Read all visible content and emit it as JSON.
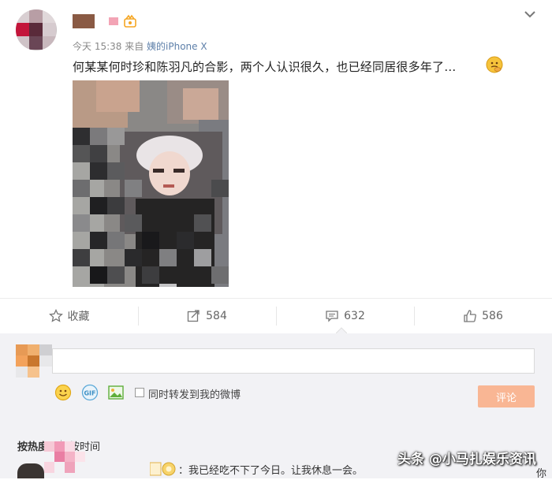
{
  "post": {
    "meta_prefix": "今天 15:38 来自 ",
    "device": "姨的iPhone X",
    "text": "何某某何时珍和陈羽凡的合影，两个人认识很久，也已经同居很多年了…",
    "icons": {
      "vip": "vip-crown-icon",
      "options": "chevron-down-icon",
      "emoji": "thinking-emoji-icon"
    }
  },
  "actions": {
    "favorite_label": "收藏",
    "repost_count": "584",
    "comment_count": "632",
    "like_count": "586"
  },
  "comment_box": {
    "input_value": "",
    "repost_checkbox_label": "同时转发到我的微博",
    "repost_checked": false,
    "submit_label": "评论",
    "tools": [
      "emoji-icon",
      "gif-icon",
      "image-icon"
    ]
  },
  "comments": {
    "sort_hot": "按热度",
    "sort_time": "按时间",
    "first_reply": "：我已经吃不下了今日。让我休息一会。"
  },
  "watermark": {
    "text": "头条 @小马扎娱乐资讯",
    "tail": "你"
  },
  "colors": {
    "accent_submit": "#f9b694",
    "meta_link": "#5d7fa9",
    "comment_bg": "#f2f2f5"
  }
}
